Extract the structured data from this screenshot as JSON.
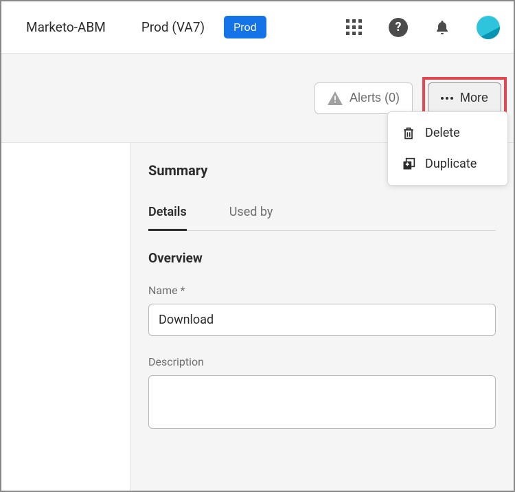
{
  "header": {
    "brand": "Marketo-ABM",
    "env": "Prod (VA7)",
    "badge": "Prod"
  },
  "actions": {
    "alerts_label": "Alerts (0)",
    "more_label": "More"
  },
  "menu": {
    "delete": "Delete",
    "duplicate": "Duplicate"
  },
  "summary": {
    "title": "Summary",
    "tabs": {
      "details": "Details",
      "used_by": "Used by"
    },
    "overview": {
      "title": "Overview",
      "name_label": "Name *",
      "name_value": "Download",
      "description_label": "Description",
      "description_value": ""
    }
  }
}
